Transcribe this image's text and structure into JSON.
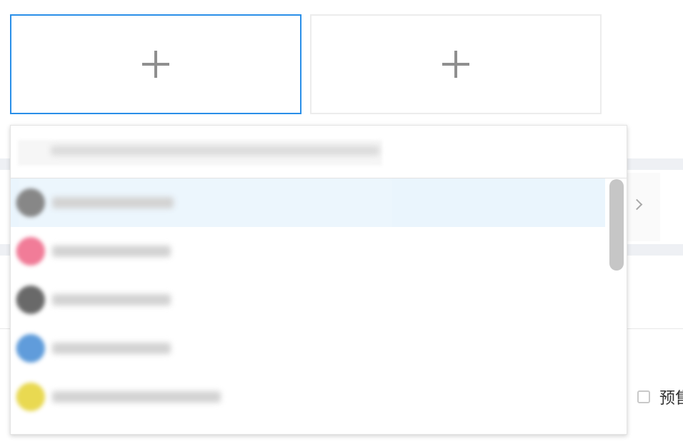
{
  "upload": {
    "slots": [
      {
        "label": "+",
        "state": "focused",
        "accent": "#2a8fe8"
      },
      {
        "label": "+",
        "state": "default",
        "accent": "#ececec"
      }
    ]
  },
  "dropdown": {
    "search_placeholder_redacted": true,
    "items": [
      {
        "avatar_color": "#777777",
        "selected": true
      },
      {
        "avatar_color": "#ef6a8a",
        "selected": false
      },
      {
        "avatar_color": "#555555",
        "selected": false
      },
      {
        "avatar_color": "#4a8fd6",
        "selected": false
      },
      {
        "avatar_color": "#e6d43a",
        "selected": false
      }
    ],
    "selected_bg": "#eaf5fd"
  },
  "background": {
    "checkbox_label": "预售"
  },
  "colors": {
    "accent": "#2a8fe8",
    "plus": "#8f8f8f",
    "scrollbar": "#c6c6c6"
  }
}
